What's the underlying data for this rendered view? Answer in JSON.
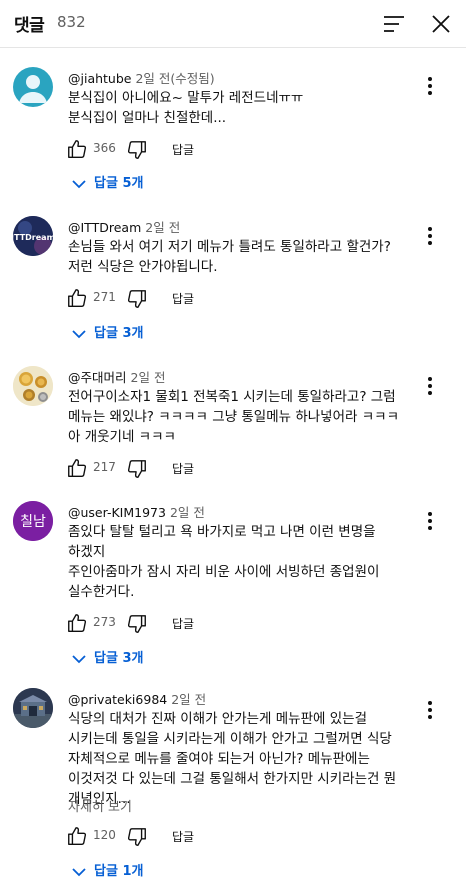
{
  "header": {
    "title": "댓글",
    "count": "832"
  },
  "comments": [
    {
      "author": "@jiahtube",
      "time": "2일 전(수정됨)",
      "text": "분식집이 아니에요~ 말투가 레전드네ㅠㅠ\n분식집이 얼마나 친절한데...",
      "likes": "366",
      "reply_label": "답글",
      "replies_label": "답글 5개",
      "avatar": {
        "type": "default",
        "bg": "#2aa4c0"
      }
    },
    {
      "author": "@ITTDream",
      "time": "2일 전",
      "text": "손님들 와서 여기 저기 메뉴가 틀려도 통일하라고 할건가?\n저런 식당은 안가야됩니다.",
      "likes": "271",
      "reply_label": "답글",
      "replies_label": "답글 3개",
      "avatar": {
        "type": "logo",
        "bg": "#1e2a5a",
        "text": "ITTDream"
      }
    },
    {
      "author": "@주대머리",
      "time": "2일 전",
      "text": "전어구이소자1 물회1 전복죽1 시키는데 통일하라고? 그럼 메뉴는 왜있냐? ㅋㅋㅋㅋ 그냥 통일메뉴 하나넣어라 ㅋㅋㅋ 아 개웃기네 ㅋㅋㅋ",
      "likes": "217",
      "reply_label": "답글",
      "avatar": {
        "type": "coins",
        "bg": "#efe6c8"
      }
    },
    {
      "author": "@user-KIM1973",
      "time": "2일 전",
      "text": "좀있다 탈탈 털리고 욕 바가지로 먹고 나면 이런 변명을 하겠지\n주인아줌마가 잠시 자리 비운 사이에 서빙하던 종업원이 실수한거다.",
      "likes": "273",
      "reply_label": "답글",
      "replies_label": "답글 3개",
      "avatar": {
        "type": "text",
        "bg": "#7b1fa2",
        "text": "칠남"
      }
    },
    {
      "author": "@privateki6984",
      "time": "2일 전",
      "text": "식당의 대처가 진짜 이해가 안가는게 메뉴판에 있는걸 시키는데 통일을 시키라는게 이해가 안가고 그럴꺼면 식당 자체적으로 메뉴를 줄여야 되는거 아닌가? 메뉴판에는 이것저것 다 있는데 그걸 통일해서 한가지만 시키라는건 뭔 개념인지...",
      "read_more": "자세히 보기",
      "likes": "120",
      "reply_label": "답글",
      "replies_label": "답글 1개",
      "avatar": {
        "type": "photo",
        "bg": "#2c3850"
      }
    }
  ]
}
